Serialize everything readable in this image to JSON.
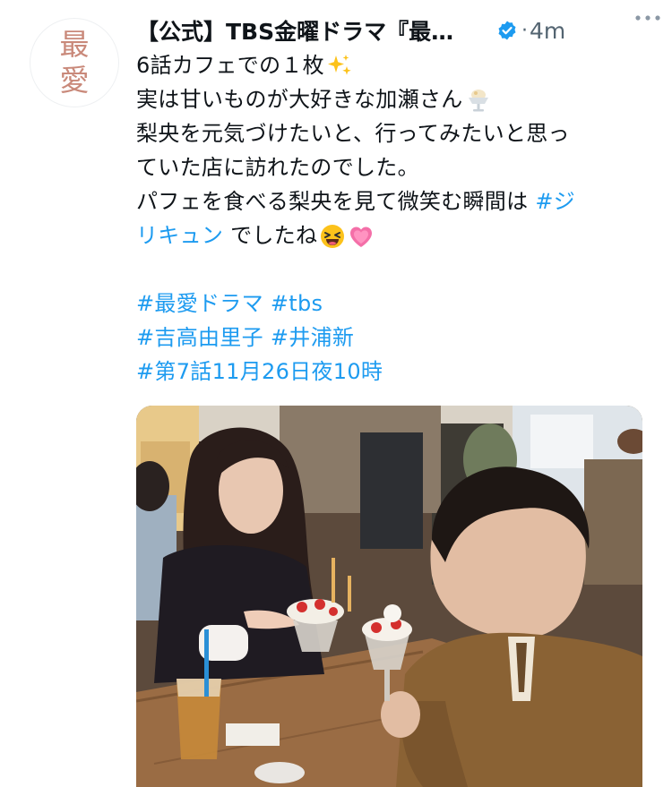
{
  "tweet": {
    "avatar_chars": [
      "最",
      "愛"
    ],
    "author_name": "【公式】TBS金曜ドラマ『最…",
    "time": "4m",
    "dot": "·",
    "verified_icon": "verified-badge-icon",
    "more_icon": "more-dots-icon",
    "lines": {
      "l1": "6話カフェでの１枚",
      "l2": "実は甘いものが大好きな加瀬さん",
      "l3": "梨央を元気づけたいと、行ってみたいと思っ",
      "l4": "ていた店に訪れたのでした。",
      "l5": "パフェを食べる梨央を見て微笑む瞬間は ",
      "l5_link": "#ジ",
      "l6_link": "リキュン",
      "l6": " でしたね"
    },
    "hashtags": {
      "h1": "#最愛ドラマ",
      "h2": "#tbs",
      "h3": "#吉高由里子",
      "h4": "#井浦新",
      "h5": "#第7話11月26日夜10時"
    },
    "emojis": [
      "sparkles-icon",
      "parfait-icon",
      "laughing-face-icon",
      "growing-heart-icon"
    ],
    "colors": {
      "link": "#1d9bf0",
      "text": "#0f1419",
      "secondary": "#536471",
      "avatar_text": "#c9897a"
    }
  }
}
